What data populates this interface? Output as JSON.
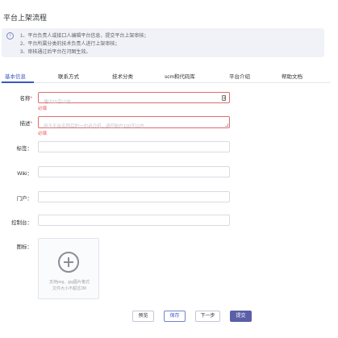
{
  "page": {
    "title": "平台上架流程"
  },
  "notice": {
    "lines": [
      "1、平台负责人或接口人编辑平台信息，提交平台上架审核；",
      "2、平台所属分类的技术负责人进行上架审核；",
      "3、审核通过后平台在河图生效。"
    ]
  },
  "tabs": [
    {
      "label": "基本信息",
      "active": true
    },
    {
      "label": "联系方式"
    },
    {
      "label": "技术分类"
    },
    {
      "label": "scm和代码库"
    },
    {
      "label": "平台介绍"
    },
    {
      "label": "帮助文档"
    }
  ],
  "form": {
    "name": {
      "label": "名称",
      "required_mark": "*",
      "placeholder": "建议15字以内",
      "value": "",
      "error": "必填"
    },
    "desc": {
      "label": "描述",
      "required_mark": "*",
      "placeholder": "用于平台名称后的一句话介绍，请控制在100字以内",
      "value": "",
      "error": "必填"
    },
    "tags": {
      "label": "标签：",
      "value": ""
    },
    "wiki": {
      "label": "Wiki：",
      "value": ""
    },
    "portal": {
      "label": "门户：",
      "value": ""
    },
    "console": {
      "label": "控制台：",
      "value": ""
    },
    "icon": {
      "label": "图标：",
      "hint_line1": "支持png、jpg图片格式",
      "hint_line2": "文件大小不超过2M"
    }
  },
  "buttons": {
    "preview": "预览",
    "save": "保存",
    "next": "下一步",
    "submit": "提交"
  },
  "colors": {
    "accent": "#3a57c4",
    "error": "#e85050",
    "primary_button": "#5a5fa8"
  },
  "icons": {
    "notice": "info-icon",
    "name_field": "document-icon",
    "upload": "plus-circle-icon"
  }
}
